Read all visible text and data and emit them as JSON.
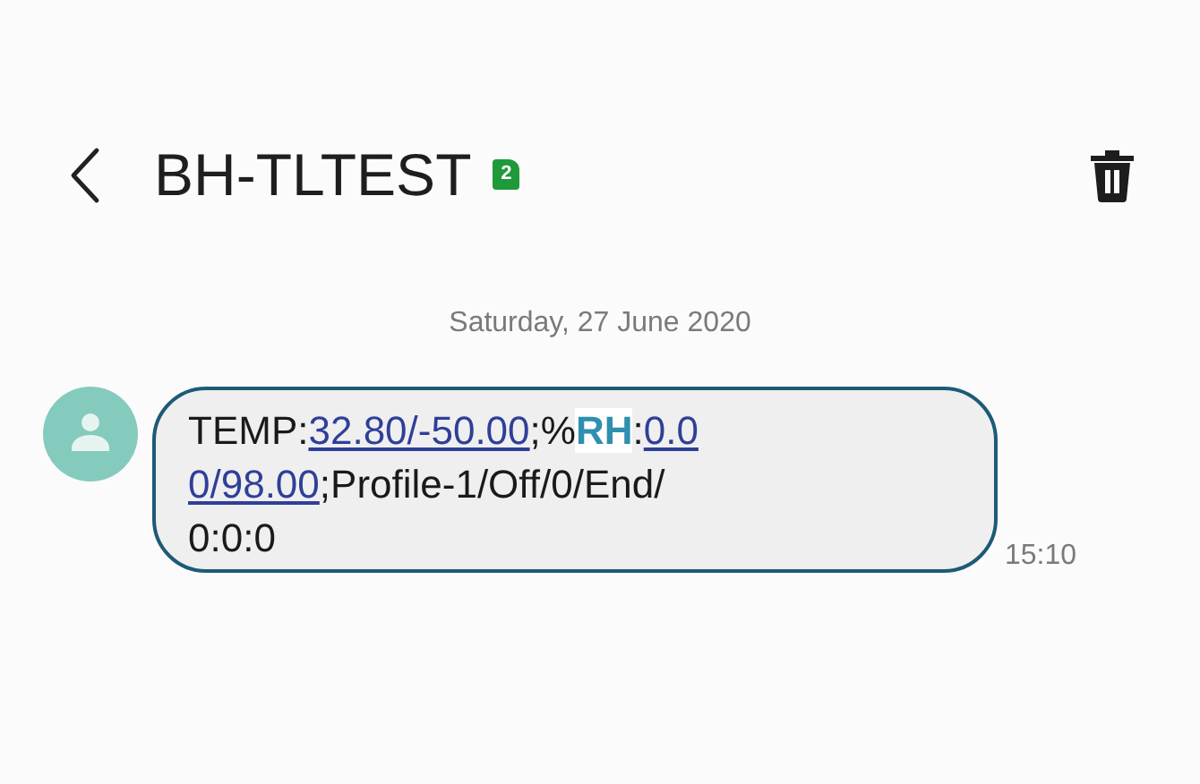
{
  "header": {
    "title": "BH-TLTEST",
    "sim_badge": "2"
  },
  "date": "Saturday, 27 June 2020",
  "messages": [
    {
      "time": "15:10",
      "lines": [
        [
          {
            "kind": "plain",
            "text": "TEMP:"
          },
          {
            "kind": "link",
            "text": "32.80/-50.00"
          },
          {
            "kind": "plain",
            "text": ";%"
          },
          {
            "kind": "highlight",
            "text": "RH"
          },
          {
            "kind": "plain",
            "text": ":"
          },
          {
            "kind": "link",
            "text": "0.0"
          }
        ],
        [
          {
            "kind": "link",
            "text": "0/98.00"
          },
          {
            "kind": "plain",
            "text": ";Profile-1/Off/0/End/"
          }
        ],
        [
          {
            "kind": "plain",
            "text": "0:0:0"
          }
        ]
      ]
    }
  ]
}
